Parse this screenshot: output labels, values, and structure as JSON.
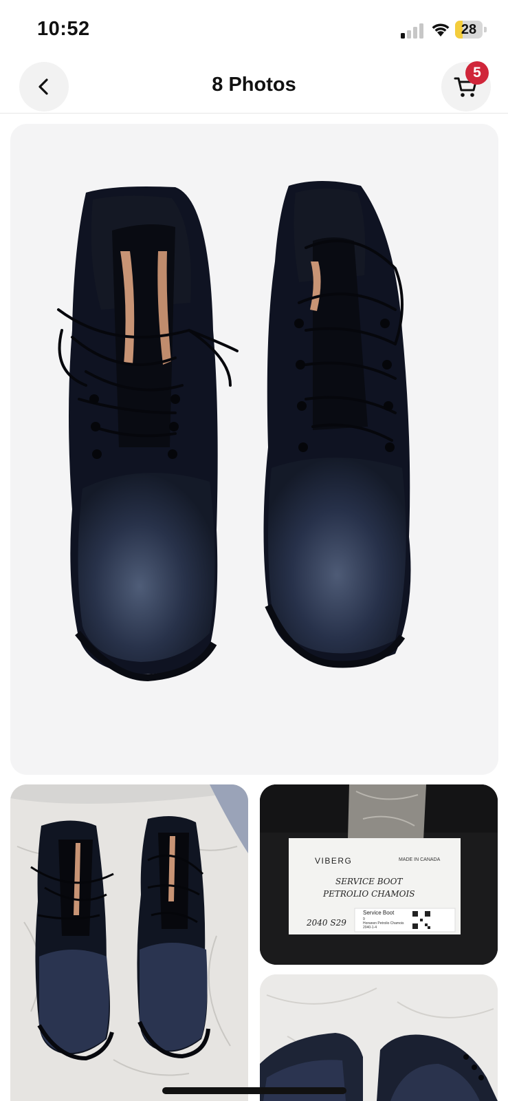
{
  "status_bar": {
    "time": "10:52",
    "battery_percent": "28",
    "battery_level": 0.28,
    "signal_bars_active": 1
  },
  "header": {
    "title": "8 Photos",
    "cart_count": "5",
    "back_icon": "chevron-left-icon",
    "cart_icon": "shopping-cart-icon"
  },
  "photos": {
    "box_label": {
      "brand": "VIBERG",
      "made_in": "MADE IN CANADA",
      "handwritten_line1": "SERVICE BOOT",
      "handwritten_line2": "PETROLIO CHAMOIS",
      "handwritten_code": "2040 S29",
      "model": "Service Boot",
      "size": "9",
      "leather": "Horween Petrolio Chamois",
      "code_small": "2040-1-4"
    }
  },
  "colors": {
    "badge": "#d0263a",
    "battery_fill": "#f4cd3c",
    "photo_background": "#f4f4f5"
  }
}
